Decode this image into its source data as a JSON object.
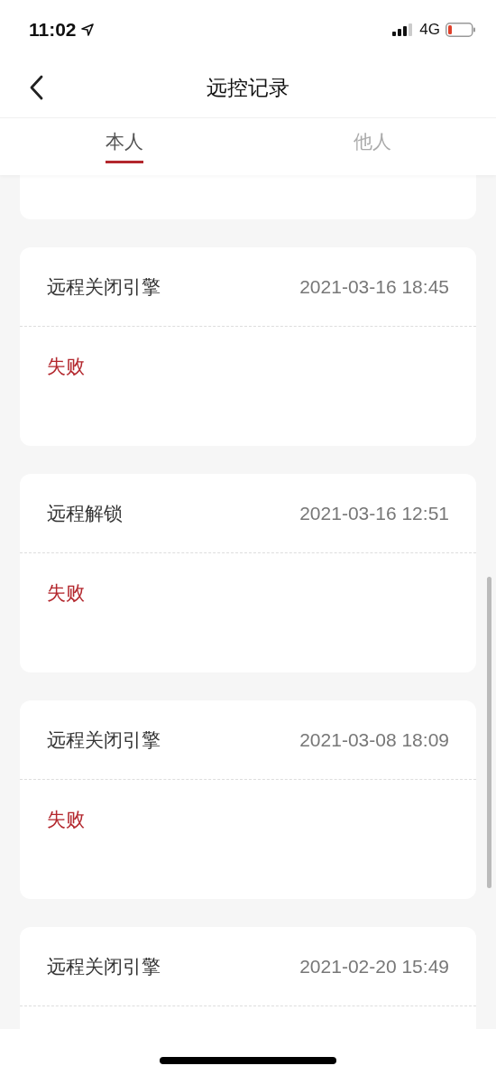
{
  "status_bar": {
    "time": "11:02",
    "network": "4G"
  },
  "nav": {
    "title": "远控记录"
  },
  "tabs": [
    {
      "label": "本人",
      "selected": true
    },
    {
      "label": "他人",
      "selected": false
    }
  ],
  "records": [
    {
      "action": "远程关闭引擎",
      "time": "2021-03-16 18:45",
      "result": "失败",
      "failed": true
    },
    {
      "action": "远程解锁",
      "time": "2021-03-16 12:51",
      "result": "失败",
      "failed": true
    },
    {
      "action": "远程关闭引擎",
      "time": "2021-03-08 18:09",
      "result": "失败",
      "failed": true
    },
    {
      "action": "远程关闭引擎",
      "time": "2021-02-20 15:49"
    }
  ]
}
